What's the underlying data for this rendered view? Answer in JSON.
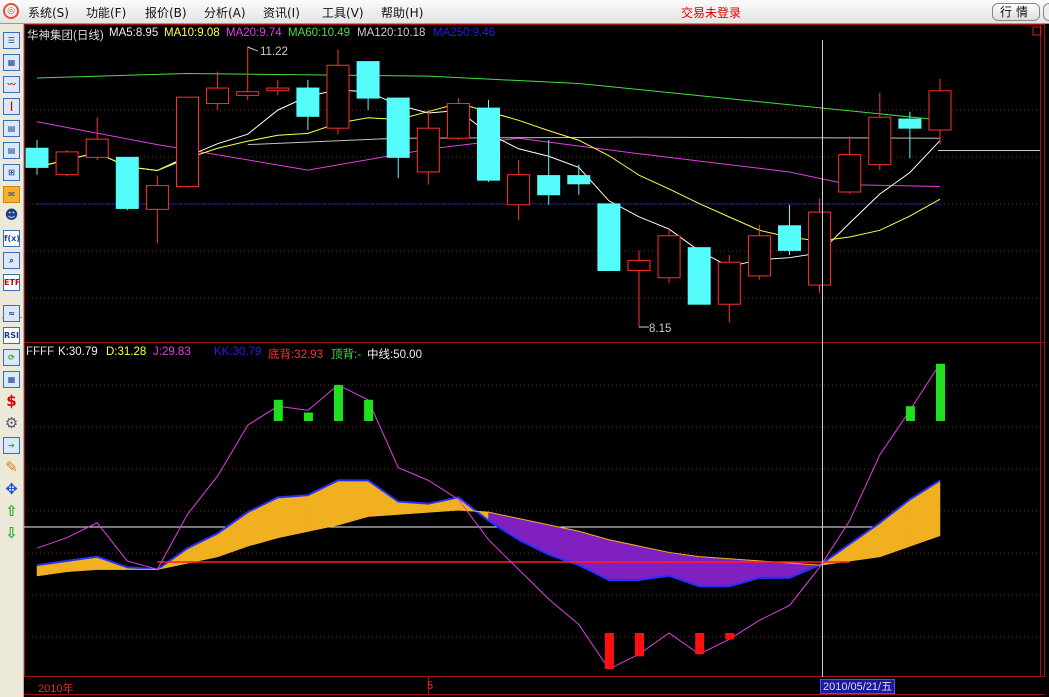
{
  "menu": {
    "items": [
      "系统(S)",
      "功能(F)",
      "报价(B)",
      "分析(A)",
      "资讯(I)",
      "工具(V)",
      "帮助(H)"
    ],
    "login_status": "交易未登录",
    "quote_button": "行情"
  },
  "toolbar": {
    "icons": [
      "report-icon",
      "grid-icon",
      "line-chart-icon",
      "candlestick-icon",
      "window-list-icon",
      "table-icon",
      "tree-icon",
      "message-icon",
      "users-icon",
      "formula-icon",
      "search-icon",
      "etf-icon",
      "wave-icon",
      "rsi-icon",
      "refresh-icon",
      "layout-icon",
      "dollar-icon",
      "tool-icon",
      "export-icon",
      "pencil-icon",
      "move-icon",
      "arrow-up-icon",
      "arrow-down-icon"
    ],
    "etf_label": "ETF",
    "rsi_label": "RSI",
    "fx_label": "f(x)",
    "dollar_label": "$"
  },
  "upper": {
    "title": "华神集团(日线)",
    "ma5": "MA5:8.95",
    "ma10": "MA10:9.08",
    "ma20": "MA20:9.74",
    "ma60": "MA60:10.49",
    "ma120": "MA120:10.18",
    "ma250": "MA250:9.46",
    "high_marker": "11.22",
    "low_marker": "8.15"
  },
  "lower": {
    "name": "FFFF",
    "k": "K:30.79",
    "d": "D:31.28",
    "j": "J:29.83",
    "kk": "KK:30.79",
    "bottom_div": "底背:32.93",
    "top_div": "顶背:-",
    "mid": "中线:50.00"
  },
  "xaxis": {
    "year": "2010年",
    "month": "5",
    "cursor_date": "2010/05/21/五"
  },
  "colors": {
    "up": "#ff3030",
    "down": "#54fcfc",
    "ma5": "#ffffff",
    "ma10": "#ffff40",
    "ma20": "#e040e0",
    "ma60": "#40e040",
    "ma120": "#c0c0c0",
    "ma250": "#2020ff",
    "orange": "#f0b020",
    "purple": "#8020c0",
    "frame": "#a01010"
  },
  "chart_data": [
    {
      "type": "candlestick",
      "title": "华神集团(日线)",
      "ohlc": [
        [
          10.11,
          9.9,
          10.2,
          9.82
        ],
        [
          9.82,
          10.07,
          10.09,
          9.8
        ],
        [
          10.01,
          10.21,
          10.45,
          9.98
        ],
        [
          10.01,
          9.45,
          10.01,
          9.43
        ],
        [
          9.44,
          9.7,
          9.81,
          9.07
        ],
        [
          9.69,
          10.67,
          10.67,
          9.68
        ],
        [
          10.6,
          10.77,
          10.95,
          10.53
        ],
        [
          10.69,
          10.73,
          11.22,
          10.64
        ],
        [
          10.74,
          10.77,
          10.86,
          10.69
        ],
        [
          10.77,
          10.46,
          10.86,
          10.31
        ],
        [
          10.33,
          11.02,
          11.19,
          10.26
        ],
        [
          11.06,
          10.66,
          11.06,
          10.53
        ],
        [
          10.66,
          10.01,
          10.66,
          9.78
        ],
        [
          9.85,
          10.33,
          10.53,
          9.71
        ],
        [
          10.22,
          10.6,
          10.66,
          10.2
        ],
        [
          10.55,
          9.76,
          10.64,
          9.74
        ],
        [
          9.49,
          9.82,
          9.98,
          9.32
        ],
        [
          9.81,
          9.6,
          10.2,
          9.49
        ],
        [
          9.81,
          9.72,
          9.93,
          9.6
        ],
        [
          9.5,
          8.77,
          9.5,
          8.77
        ],
        [
          8.77,
          8.88,
          8.99,
          8.15
        ],
        [
          8.69,
          9.15,
          9.21,
          8.63
        ],
        [
          9.02,
          8.4,
          9.02,
          8.4
        ],
        [
          8.4,
          8.86,
          8.94,
          8.2
        ],
        [
          8.71,
          9.15,
          9.27,
          8.67
        ],
        [
          9.26,
          8.99,
          9.49,
          8.94
        ],
        [
          8.61,
          9.41,
          9.56,
          8.52
        ],
        [
          9.63,
          10.04,
          10.24,
          9.61
        ],
        [
          9.93,
          10.45,
          10.72,
          9.87
        ],
        [
          10.43,
          10.33,
          10.51,
          10.0
        ],
        [
          10.31,
          10.74,
          10.87,
          10.15
        ]
      ],
      "ma_lines": {
        "ma20": [
          [
            0,
            10.4
          ],
          [
            4,
            10.15
          ],
          [
            9,
            9.87
          ],
          [
            13,
            10.1
          ],
          [
            16,
            10.22
          ],
          [
            20,
            10.05
          ],
          [
            25,
            9.85
          ],
          [
            27,
            9.71
          ],
          [
            30,
            9.69
          ]
        ],
        "ma60": [
          [
            0,
            10.88
          ],
          [
            5,
            10.93
          ],
          [
            13,
            10.9
          ],
          [
            18,
            10.82
          ],
          [
            24,
            10.62
          ],
          [
            30,
            10.42
          ]
        ],
        "ma120": [
          [
            7,
            10.15
          ],
          [
            12,
            10.22
          ],
          [
            20,
            10.23
          ],
          [
            30,
            10.22
          ]
        ],
        "ma250": [
          [
            0,
            9.5
          ],
          [
            30,
            9.5
          ]
        ]
      },
      "ylim": [
        8.0,
        11.5
      ]
    },
    {
      "type": "line",
      "title": "FFFF",
      "j": [
        40,
        45,
        52,
        34,
        30,
        56,
        74,
        98,
        107,
        105,
        117,
        110,
        78,
        72,
        63,
        44,
        30,
        16,
        4,
        -17,
        -10,
        0,
        -10,
        -3,
        6,
        13,
        31,
        53,
        84,
        105,
        127
      ],
      "k": [
        32,
        34,
        36,
        31,
        30,
        40,
        47,
        57,
        64,
        65,
        72,
        72,
        62,
        61,
        64,
        53,
        44,
        37,
        32,
        25,
        25,
        27,
        22,
        22,
        26,
        26,
        32,
        42,
        52,
        63,
        72
      ],
      "d": [
        27,
        29,
        30,
        30,
        30,
        33,
        36,
        41,
        45,
        48,
        51,
        55,
        56,
        57,
        58,
        57,
        54,
        51,
        48,
        44,
        41,
        38,
        36,
        35,
        34,
        33,
        32,
        34,
        36,
        41,
        46
      ],
      "green_bars": [
        [
          8,
          110
        ],
        [
          9,
          104
        ],
        [
          10,
          117
        ],
        [
          11,
          110
        ],
        [
          29,
          107
        ],
        [
          30,
          127
        ]
      ],
      "red_bars": [
        [
          19,
          -17
        ],
        [
          20,
          -11
        ],
        [
          22,
          -10
        ],
        [
          23,
          -3
        ]
      ],
      "mid": 50,
      "bottom_line": 33.5,
      "ylim": [
        -20,
        135
      ]
    }
  ]
}
